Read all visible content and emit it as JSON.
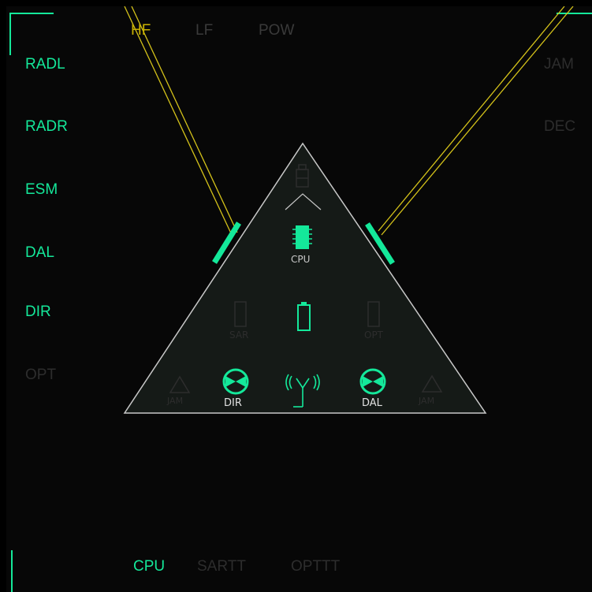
{
  "colors": {
    "accent": "#14e89a",
    "inactive": "#2d2d2d",
    "yellow_line": "#d4c21a",
    "triangle_fill": "#151a17",
    "triangle_stroke": "#c8c8c8",
    "active_tab": "#c8b000"
  },
  "top_tabs": [
    {
      "label": "HF",
      "state": "active"
    },
    {
      "label": "LF",
      "state": "inactive"
    },
    {
      "label": "POW",
      "state": "inactive"
    }
  ],
  "left_menu": [
    {
      "label": "RADL",
      "state": "on"
    },
    {
      "label": "RADR",
      "state": "on"
    },
    {
      "label": "ESM",
      "state": "on"
    },
    {
      "label": "DAL",
      "state": "on"
    },
    {
      "label": "DIR",
      "state": "on"
    },
    {
      "label": "OPT",
      "state": "off"
    }
  ],
  "right_menu": [
    {
      "label": "JAM",
      "state": "off"
    },
    {
      "label": "DEC",
      "state": "off"
    }
  ],
  "bottom_tabs": [
    {
      "label": "CPU",
      "state": "on"
    },
    {
      "label": "SARTT",
      "state": "off"
    },
    {
      "label": "OPTTT",
      "state": "off"
    }
  ],
  "ship": {
    "cpu_label": "CPU",
    "sar_label": "SAR",
    "opt_label": "OPT",
    "dir_label": "DIR",
    "dal_label": "DAL",
    "jam_left_label": "JAM",
    "jam_right_label": "JAM"
  },
  "icons": {
    "top_module": "hourglass-icon",
    "chevron": "chevron-up-icon",
    "cpu": "chip-icon",
    "sar": "empty-slot-icon",
    "battery": "battery-icon",
    "opt": "empty-slot-icon",
    "dir": "dish-icon",
    "antenna": "antenna-icon",
    "dal": "dish-icon",
    "jam": "triangle-icon"
  }
}
